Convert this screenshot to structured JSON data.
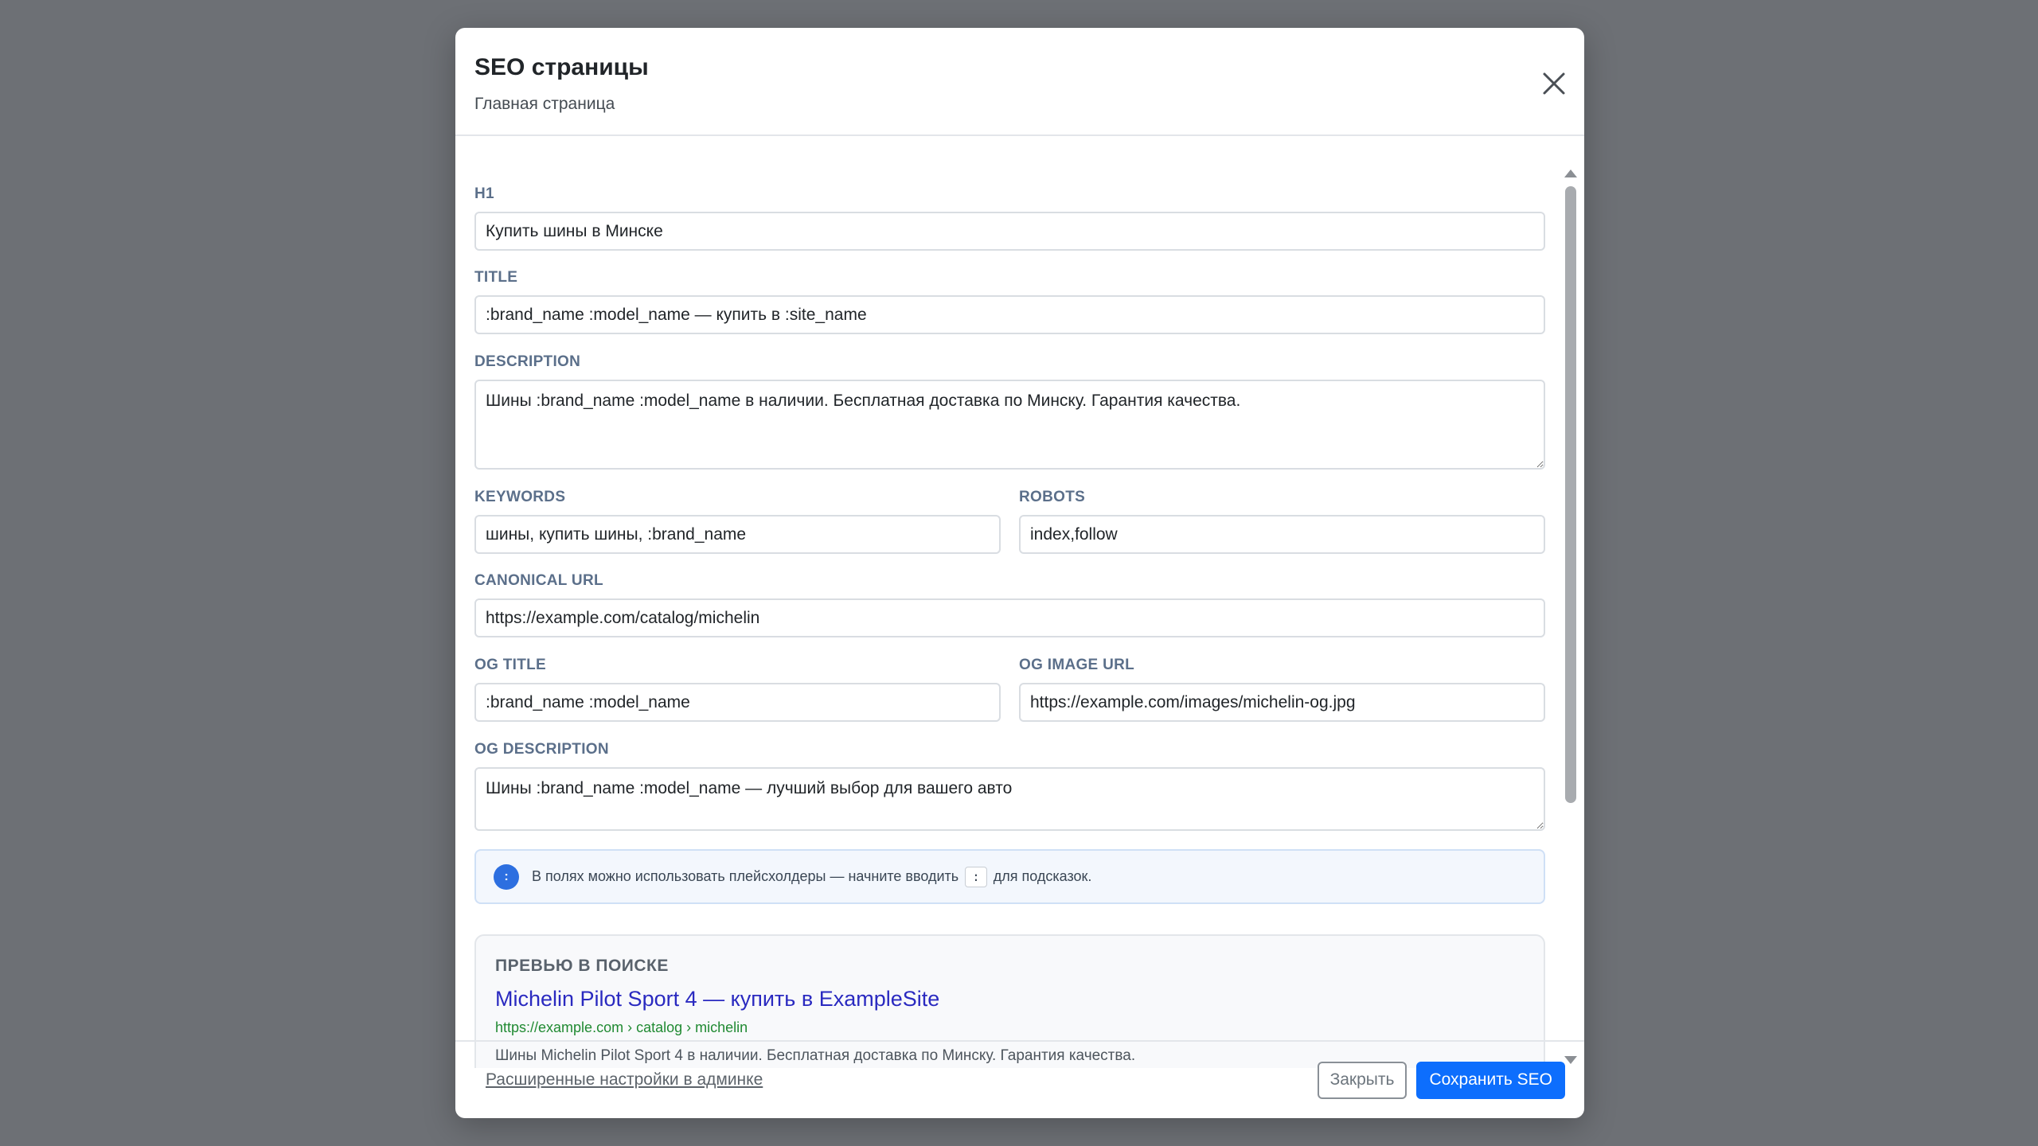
{
  "modal": {
    "title": "SEO страницы",
    "subtitle": "Главная страница",
    "close_icon": "close-icon"
  },
  "fields": {
    "h1": {
      "label": "H1",
      "value": "Купить шины в Минске"
    },
    "title": {
      "label": "TITLE",
      "value": ":brand_name :model_name — купить в :site_name"
    },
    "description": {
      "label": "DESCRIPTION",
      "value": "Шины :brand_name :model_name в наличии. Бесплатная доставка по Минску. Гарантия качества."
    },
    "keywords": {
      "label": "KEYWORDS",
      "value": "шины, купить шины, :brand_name"
    },
    "robots": {
      "label": "ROBOTS",
      "value": "index,follow"
    },
    "canonical": {
      "label": "CANONICAL URL",
      "value": "https://example.com/catalog/michelin"
    },
    "og_title": {
      "label": "OG TITLE",
      "value": ":brand_name :model_name"
    },
    "og_image": {
      "label": "OG IMAGE URL",
      "value": "https://example.com/images/michelin-og.jpg"
    },
    "og_description": {
      "label": "OG DESCRIPTION",
      "value": "Шины :brand_name :model_name — лучший выбор для вашего авто"
    }
  },
  "hint": {
    "icon": "info-icon",
    "icon_glyph": ":",
    "text_before": "В полях можно использовать плейсхолдеры — начните вводить",
    "key": ":",
    "text_after": "для подсказок."
  },
  "preview": {
    "heading": "ПРЕВЬЮ В ПОИСКЕ",
    "title": "Michelin Pilot Sport 4 — купить в ExampleSite",
    "url": "https://example.com › catalog › michelin",
    "description": "Шины Michelin Pilot Sport 4 в наличии. Бесплатная доставка по Минску. Гарантия качества."
  },
  "footer": {
    "advanced_link": "Расширенные настройки в админке",
    "close_label": "Закрыть",
    "save_label": "Сохранить SEO"
  },
  "colors": {
    "backdrop": "#6d7075",
    "primary": "#0d6efd",
    "label": "#5b6f8a",
    "preview_link": "#2a2ac0",
    "preview_url": "#208a32"
  }
}
